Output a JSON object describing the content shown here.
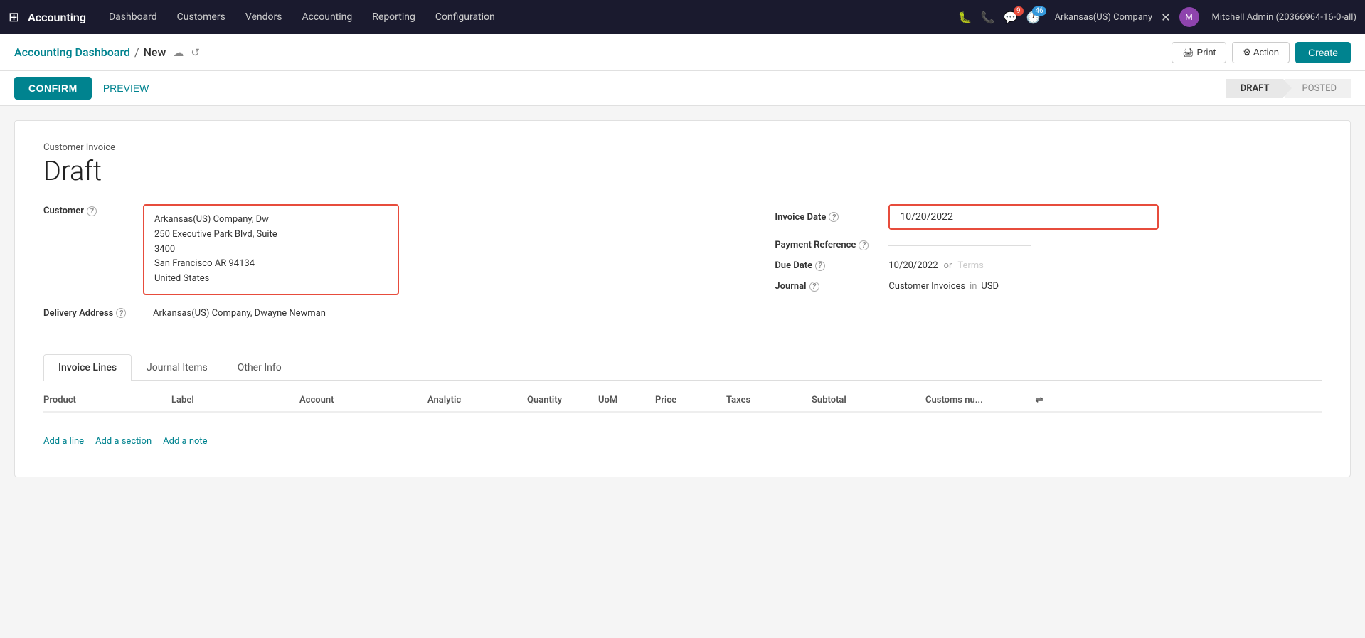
{
  "app": {
    "brand": "Accounting",
    "grid_icon": "⊞"
  },
  "nav": {
    "items": [
      {
        "label": "Dashboard"
      },
      {
        "label": "Customers"
      },
      {
        "label": "Vendors"
      },
      {
        "label": "Accounting"
      },
      {
        "label": "Reporting"
      },
      {
        "label": "Configuration"
      }
    ],
    "icons": {
      "bug": "🐛",
      "phone": "📞",
      "chat_count": "9",
      "activity_count": "46"
    },
    "company": "Arkansas(US) Company",
    "user": "Mitchell Admin (20366964-16-0-all)"
  },
  "breadcrumb": {
    "link": "Accounting Dashboard",
    "separator": "/",
    "current": "New",
    "cloud_icon": "☁",
    "refresh_icon": "↺"
  },
  "toolbar": {
    "print_label": "🖨 Print",
    "action_label": "⚙ Action",
    "create_label": "Create"
  },
  "status": {
    "confirm_label": "CONFIRM",
    "preview_label": "PREVIEW",
    "steps": [
      {
        "label": "DRAFT",
        "active": true
      },
      {
        "label": "POSTED",
        "active": false
      }
    ]
  },
  "invoice": {
    "type": "Customer Invoice",
    "draft_label": "Draft",
    "customer_label": "Customer",
    "customer_value_line1": "Arkansas(US) Company, Dw",
    "customer_value_line2": "250 Executive Park Blvd, Suite",
    "customer_value_line3": "3400",
    "customer_value_line4": "San Francisco AR 94134",
    "customer_value_line5": "United States",
    "delivery_address_label": "Delivery Address",
    "delivery_address_value": "Arkansas(US) Company, Dwayne Newman",
    "invoice_date_label": "Invoice Date",
    "invoice_date_value": "10/20/2022",
    "payment_reference_label": "Payment Reference",
    "due_date_label": "Due Date",
    "due_date_value": "10/20/2022",
    "or_label": "or",
    "terms_placeholder": "Terms",
    "journal_label": "Journal",
    "journal_value": "Customer Invoices",
    "in_label": "in",
    "currency_value": "USD"
  },
  "tabs": [
    {
      "label": "Invoice Lines",
      "active": true
    },
    {
      "label": "Journal Items",
      "active": false
    },
    {
      "label": "Other Info",
      "active": false
    }
  ],
  "table": {
    "columns": [
      {
        "label": "Product"
      },
      {
        "label": "Label"
      },
      {
        "label": "Account"
      },
      {
        "label": "Analytic"
      },
      {
        "label": "Quantity"
      },
      {
        "label": "UoM"
      },
      {
        "label": "Price"
      },
      {
        "label": "Taxes"
      },
      {
        "label": "Subtotal"
      },
      {
        "label": "Customs nu..."
      }
    ],
    "actions": [
      {
        "label": "Add a line"
      },
      {
        "label": "Add a section"
      },
      {
        "label": "Add a note"
      }
    ]
  }
}
